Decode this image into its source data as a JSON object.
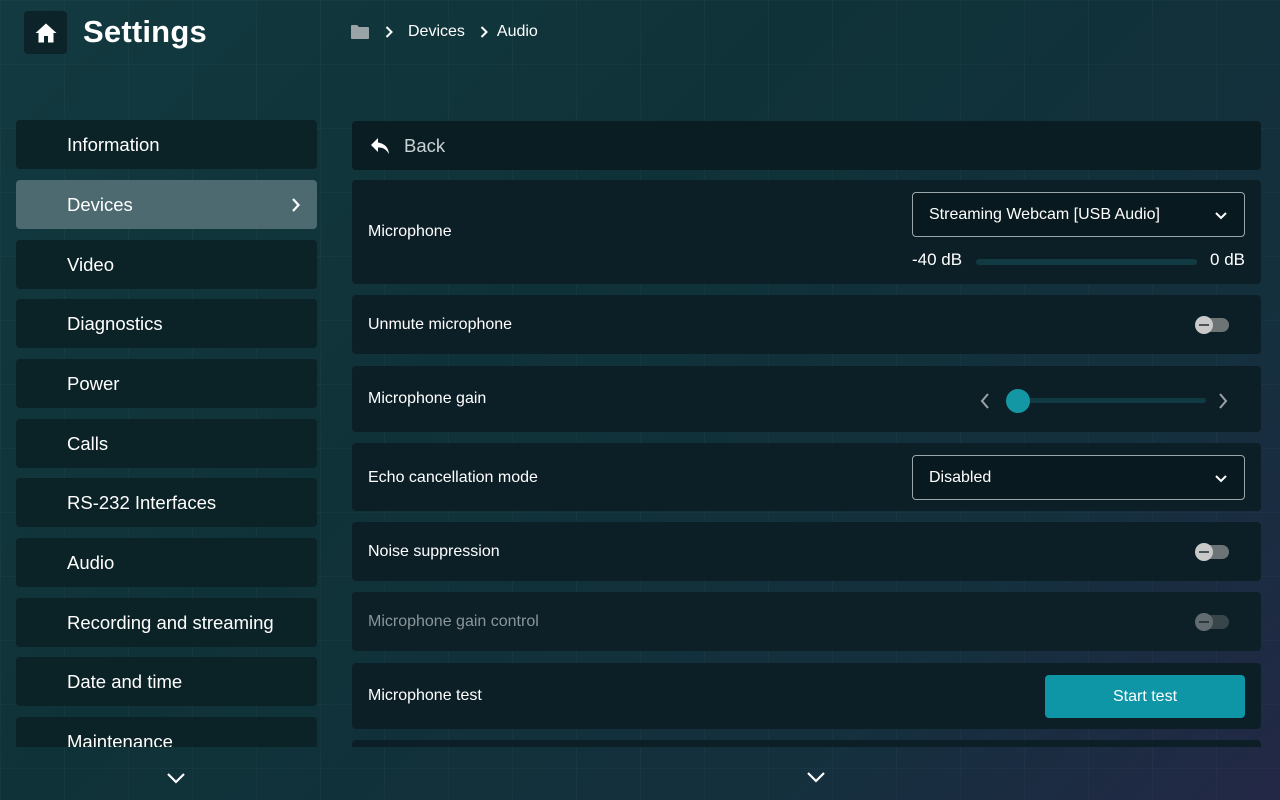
{
  "header": {
    "title": "Settings",
    "home_icon": "home-icon",
    "breadcrumb": {
      "root_icon": "folder-icon",
      "items": [
        "Devices",
        "Audio"
      ]
    }
  },
  "sidebar": {
    "items": [
      {
        "label": "Information"
      },
      {
        "label": "Devices",
        "active": true
      },
      {
        "label": "Video"
      },
      {
        "label": "Diagnostics"
      },
      {
        "label": "Power"
      },
      {
        "label": "Calls"
      },
      {
        "label": "RS-232 Interfaces"
      },
      {
        "label": "Audio"
      },
      {
        "label": "Recording and streaming"
      },
      {
        "label": "Date and time"
      },
      {
        "label": "Maintenance"
      }
    ]
  },
  "main": {
    "back_label": "Back",
    "microphone": {
      "label": "Microphone",
      "selected": "Streaming Webcam [USB Audio]",
      "meter_min": "-40 dB",
      "meter_max": "0 dB",
      "meter_level": 0
    },
    "unmute": {
      "label": "Unmute microphone",
      "on": false
    },
    "gain": {
      "label": "Microphone gain",
      "level": 0.05
    },
    "echo": {
      "label": "Echo cancellation mode",
      "selected": "Disabled"
    },
    "noise": {
      "label": "Noise suppression",
      "on": false
    },
    "gain_control": {
      "label": "Microphone gain control",
      "on": false,
      "disabled": true
    },
    "test": {
      "label": "Microphone test",
      "button": "Start test"
    }
  },
  "colors": {
    "accent": "#0e96a6",
    "active_item": "#4c6a70",
    "panel": "#0c1f26"
  }
}
